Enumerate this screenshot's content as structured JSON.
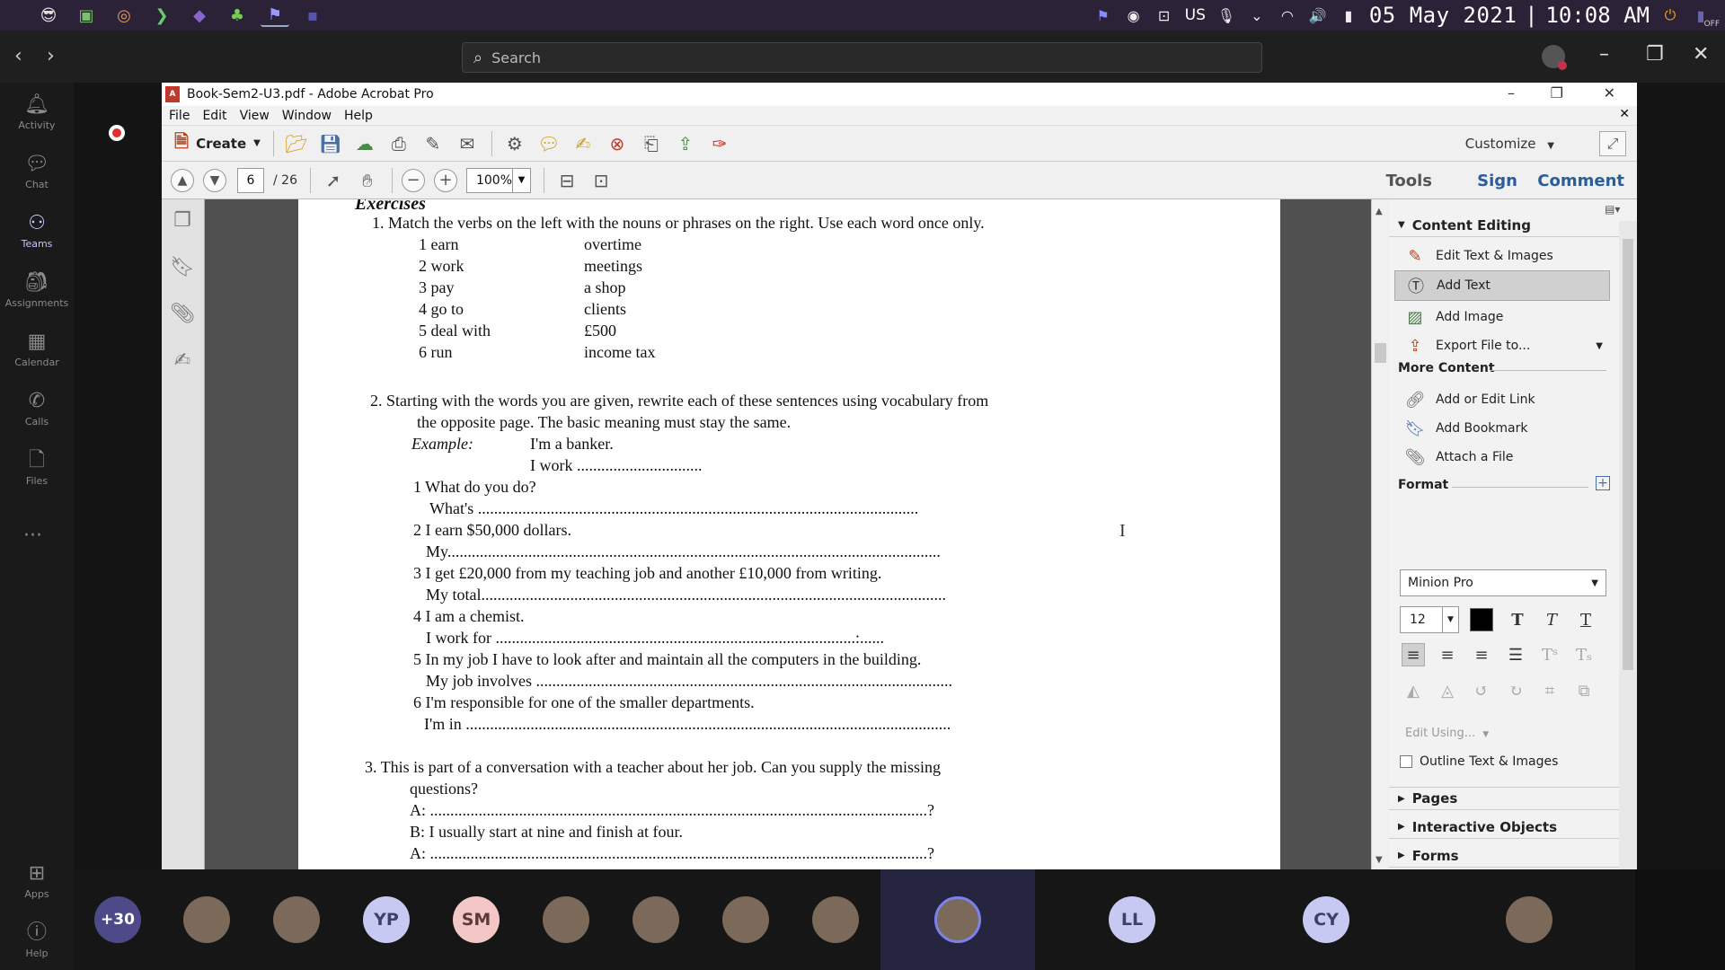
{
  "taskbar": {
    "apps": [
      "emoji-app",
      "file-explorer-app",
      "browser-app",
      "terminal-app",
      "vs-app",
      "android-app",
      "teams-app",
      "blank-app"
    ],
    "language": "US",
    "date": "05 May 2021",
    "separator": "|",
    "time": "10:08 AM",
    "corner_label": "OFF"
  },
  "teams": {
    "search_placeholder": "Search",
    "rail": [
      {
        "label": "Activity",
        "icon": "bell-icon"
      },
      {
        "label": "Chat",
        "icon": "chat-icon"
      },
      {
        "label": "Teams",
        "icon": "teams-icon",
        "active": true
      },
      {
        "label": "Assignments",
        "icon": "assignments-icon"
      },
      {
        "label": "Calendar",
        "icon": "calendar-icon"
      },
      {
        "label": "Calls",
        "icon": "phone-icon"
      },
      {
        "label": "Files",
        "icon": "files-icon"
      }
    ],
    "rail_bottom": [
      {
        "label": "Apps",
        "icon": "apps-icon"
      },
      {
        "label": "Help",
        "icon": "help-icon"
      }
    ]
  },
  "acrobat": {
    "title": "Book-Sem2-U3.pdf - Adobe Acrobat Pro",
    "menu": [
      "File",
      "Edit",
      "View",
      "Window",
      "Help"
    ],
    "create_label": "Create",
    "customize_label": "Customize",
    "page_current": "6",
    "page_total": "/ 26",
    "zoom": "100%",
    "tabs": {
      "tools": "Tools",
      "sign": "Sign",
      "comment": "Comment"
    }
  },
  "document": {
    "heading": "Exercises",
    "ex1_title": "1. Match the verbs on the left with the nouns or phrases on the right. Use each word once only.",
    "ex1_left": [
      "1 earn",
      "2 work",
      "3 pay",
      "4 go to",
      "5 deal with",
      "6 run"
    ],
    "ex1_right": [
      "overtime",
      "meetings",
      "a shop",
      "clients",
      "£500",
      "income tax"
    ],
    "ex2_title_l1": "2. Starting with the words you are given, rewrite each of these sentences using vocabulary from",
    "ex2_title_l2": "the opposite page. The basic meaning must stay the same.",
    "ex2_example_label": "Example:",
    "ex2_example_l1": "I'm a banker.",
    "ex2_example_l2": "I work ...............................",
    "ex2_items": [
      {
        "q": "1 What do you do?",
        "a": "What's ............................................................................................................."
      },
      {
        "q": "2 I earn $50,000 dollars.",
        "a": "My.........................................................................................................................."
      },
      {
        "q": "3 I get £20,000 from my teaching job and another £10,000 from writing.",
        "a": "My total..................................................................................................................."
      },
      {
        "q": "4 I am a chemist.",
        "a": "I work for .........................................................................................:......"
      },
      {
        "q": "5 In my job I have to look after and maintain all the computers in the building.",
        "a": "My job involves ......................................................................................................."
      },
      {
        "q": "6 I'm responsible for one of the smaller departments.",
        "a": "I'm in ........................................................................................................................"
      }
    ],
    "ex3_title_l1": "3. This is part of a conversation with a teacher about her job. Can you supply the missing",
    "ex3_title_l2": "questions?",
    "ex3_a1": "A: ...........................................................................................................................?",
    "ex3_b1": "B: I usually start at nine and finish at four.",
    "ex3_a2": "A: ...........................................................................................................................?"
  },
  "tools_pane": {
    "content_editing": "Content Editing",
    "edit_text_images": "Edit Text & Images",
    "add_text": "Add Text",
    "add_image": "Add Image",
    "export_file": "Export File to...",
    "more_content": "More Content",
    "add_edit_link": "Add or Edit Link",
    "add_bookmark": "Add Bookmark",
    "attach_file": "Attach a File",
    "format": "Format",
    "font_name": "Minion Pro",
    "font_size": "12",
    "edit_using": "Edit Using...",
    "outline": "Outline Text & Images",
    "pages": "Pages",
    "interactive_objects": "Interactive Objects",
    "forms": "Forms"
  },
  "participants": [
    {
      "type": "more",
      "label": "+30"
    },
    {
      "type": "photo",
      "label": ""
    },
    {
      "type": "photo",
      "label": ""
    },
    {
      "type": "initials",
      "label": "YP"
    },
    {
      "type": "initials-sm",
      "label": "SM"
    },
    {
      "type": "photo",
      "label": ""
    },
    {
      "type": "photo",
      "label": ""
    },
    {
      "type": "photo",
      "label": ""
    },
    {
      "type": "photo",
      "label": ""
    },
    {
      "type": "photo-active",
      "label": ""
    },
    {
      "type": "initials",
      "label": "LL"
    },
    {
      "type": "initials",
      "label": "CY"
    },
    {
      "type": "photo",
      "label": ""
    }
  ]
}
